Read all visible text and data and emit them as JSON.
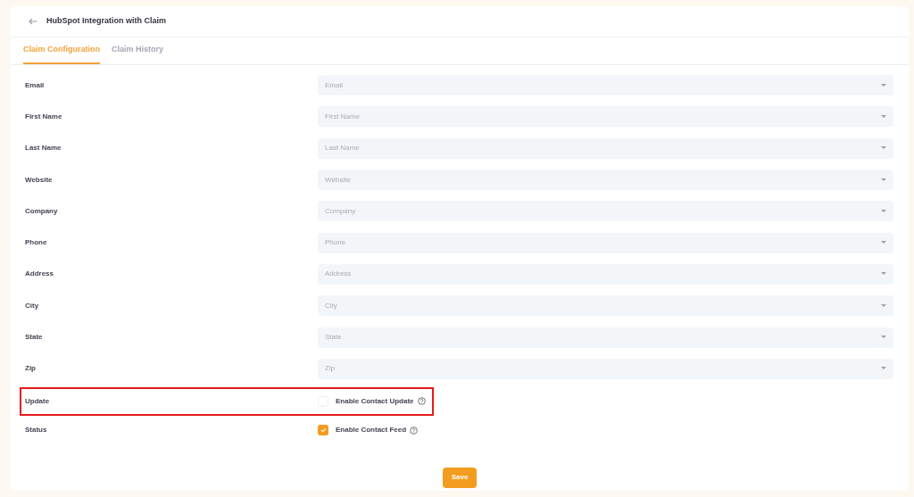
{
  "header": {
    "title": "HubSpot Integration with Claim"
  },
  "tabs": [
    {
      "label": "Claim Configuration",
      "selected": true
    },
    {
      "label": "Claim History",
      "selected": false
    }
  ],
  "fields": [
    {
      "label": "Email",
      "placeholder": "Email"
    },
    {
      "label": "First Name",
      "placeholder": "First Name"
    },
    {
      "label": "Last Name",
      "placeholder": "Last Name"
    },
    {
      "label": "Website",
      "placeholder": "Website"
    },
    {
      "label": "Company",
      "placeholder": "Company"
    },
    {
      "label": "Phone",
      "placeholder": "Phone"
    },
    {
      "label": "Address",
      "placeholder": "Address"
    },
    {
      "label": "City",
      "placeholder": "City"
    },
    {
      "label": "State",
      "placeholder": "State"
    },
    {
      "label": "Zip",
      "placeholder": "Zip"
    }
  ],
  "checks": [
    {
      "label": "Update",
      "option": "Enable Contact Update",
      "checked": false,
      "highlighted": true
    },
    {
      "label": "Status",
      "option": "Enable Contact Feed",
      "checked": true,
      "highlighted": false
    }
  ],
  "save_button": "Save"
}
